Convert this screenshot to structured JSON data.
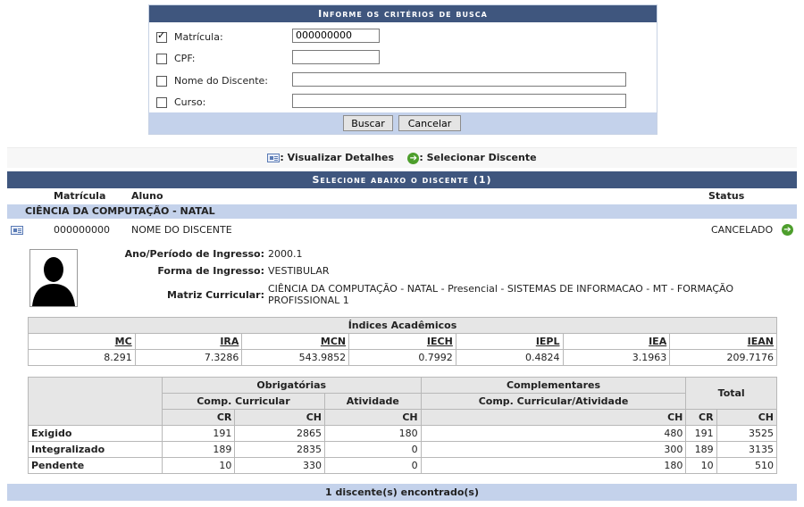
{
  "search": {
    "title": "Informe os critérios de busca",
    "fields": [
      {
        "label": "Matrícula:",
        "checked": true,
        "value": "000000000"
      },
      {
        "label": "CPF:",
        "checked": false,
        "value": ""
      },
      {
        "label": "Nome do Discente:",
        "checked": false,
        "value": ""
      },
      {
        "label": "Curso:",
        "checked": false,
        "value": ""
      }
    ],
    "search_label": "Buscar",
    "cancel_label": "Cancelar"
  },
  "legend": {
    "details_label": ": Visualizar Detalhes",
    "select_label": ": Selecionar Discente"
  },
  "listing": {
    "title": "Selecione abaixo o discente (1)",
    "col_matricula": "Matrícula",
    "col_aluno": "Aluno",
    "col_status": "Status",
    "course": "CIÊNCIA DA COMPUTAÇÃO - NATAL",
    "student": {
      "matricula": "000000000",
      "name": "NOME DO DISCENTE",
      "status": "CANCELADO"
    },
    "details": {
      "ano_label": "Ano/Período de Ingresso:",
      "ano_value": "2000.1",
      "forma_label": "Forma de Ingresso:",
      "forma_value": "VESTIBULAR",
      "matriz_label": "Matriz Curricular:",
      "matriz_value_line1": "CIÊNCIA DA COMPUTAÇÃO - NATAL - Presencial - SISTEMAS DE INFORMACAO - MT - FORMAÇÃO",
      "matriz_value_line2": "PROFISSIONAL 1"
    },
    "indices": {
      "title": "Índices Acadêmicos",
      "headers": [
        "MC",
        "IRA",
        "MCN",
        "IECH",
        "IEPL",
        "IEA",
        "IEAN"
      ],
      "values": [
        "8.291",
        "7.3286",
        "543.9852",
        "0.7992",
        "0.4824",
        "3.1963",
        "209.7176"
      ]
    },
    "workload": {
      "obrigatorias": "Obrigatórias",
      "complementares": "Complementares",
      "total": "Total",
      "comp_curricular": "Comp. Curricular",
      "atividade": "Atividade",
      "comp_curricular_atividade": "Comp. Curricular/Atividade",
      "cr": "CR",
      "ch": "CH",
      "rows": [
        {
          "label": "Exigido",
          "cr": "191",
          "ch": "2865",
          "ativ": "180",
          "comp": "480",
          "tcr": "191",
          "tch": "3525"
        },
        {
          "label": "Integralizado",
          "cr": "189",
          "ch": "2835",
          "ativ": "0",
          "comp": "300",
          "tcr": "189",
          "tch": "3135"
        },
        {
          "label": "Pendente",
          "cr": "10",
          "ch": "330",
          "ativ": "0",
          "comp": "180",
          "tcr": "10",
          "tch": "510"
        }
      ]
    },
    "footer": "1 discente(s) encontrado(s)"
  }
}
